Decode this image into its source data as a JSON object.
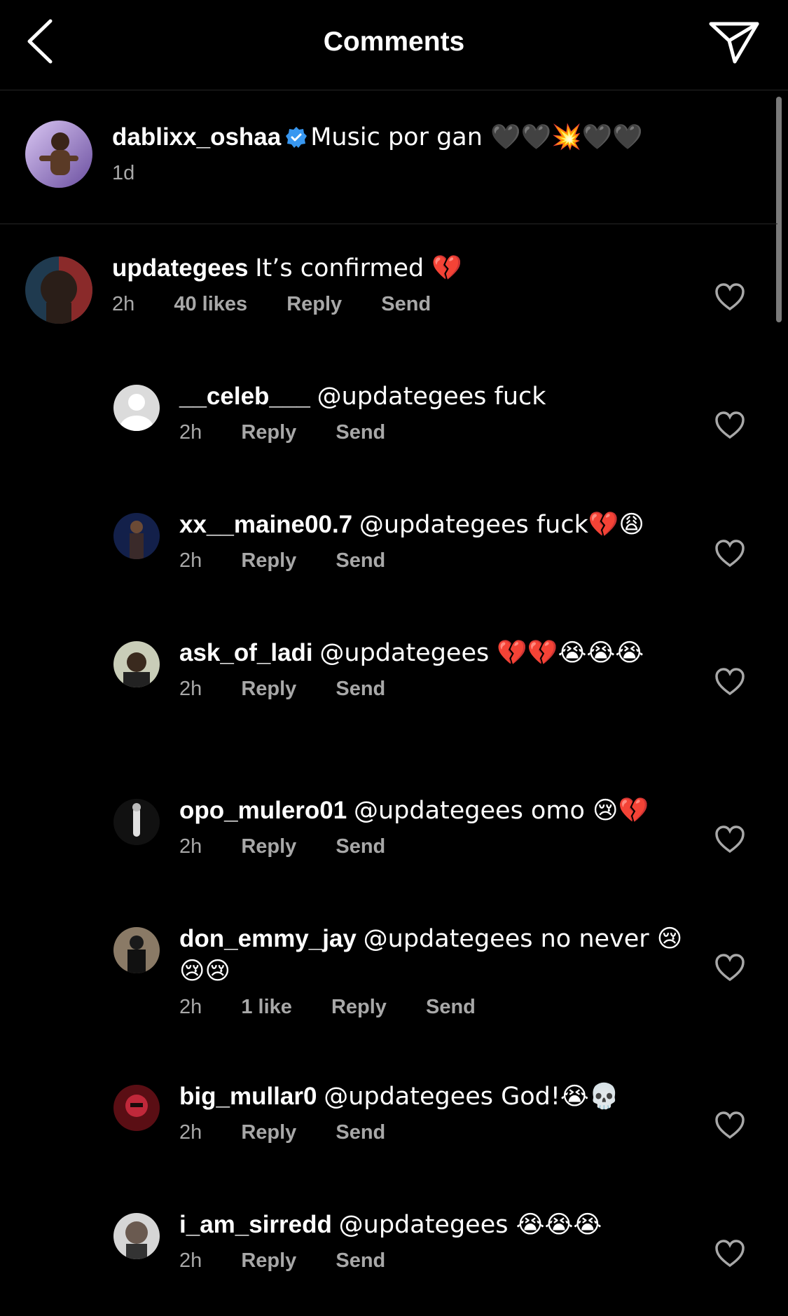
{
  "header": {
    "title": "Comments",
    "back_icon": "chevron-left-icon",
    "share_icon": "paper-plane-icon"
  },
  "caption": {
    "username": "dablixx_oshaa",
    "verified": true,
    "text": "Music por gan 🖤🖤💥🖤🖤",
    "time": "1d"
  },
  "comments": [
    {
      "username": "updategees",
      "text": "It’s confirmed 💔",
      "time": "2h",
      "likes": "40 likes",
      "reply": "Reply",
      "send": "Send"
    },
    {
      "username": "__celeb___",
      "text": "@updategees fuck",
      "time": "2h",
      "likes": "",
      "reply": "Reply",
      "send": "Send"
    },
    {
      "username": "xx__maine00.7",
      "text": "@updategees fuck💔😩",
      "time": "2h",
      "likes": "",
      "reply": "Reply",
      "send": "Send"
    },
    {
      "username": "ask_of_ladi",
      "text": "@updategees 💔💔😭😭😭",
      "time": "2h",
      "likes": "",
      "reply": "Reply",
      "send": "Send"
    },
    {
      "username": "opo_mulero01",
      "text": "@updategees omo 😢💔",
      "time": "2h",
      "likes": "",
      "reply": "Reply",
      "send": "Send"
    },
    {
      "username": "don_emmy_jay",
      "text": "@updategees no never 😢😢😢",
      "time": "2h",
      "likes": "1 like",
      "reply": "Reply",
      "send": "Send"
    },
    {
      "username": "big_mullar0",
      "text": "@updategees God!😭💀",
      "time": "2h",
      "likes": "",
      "reply": "Reply",
      "send": "Send"
    },
    {
      "username": "i_am_sirredd",
      "text": "@updategees 😭😭😭",
      "time": "2h",
      "likes": "",
      "reply": "Reply",
      "send": "Send"
    }
  ],
  "colors": {
    "background": "#000000",
    "text": "#ffffff",
    "secondary": "#a8a8a8",
    "divider": "#262626",
    "verified": "#3897f0"
  }
}
